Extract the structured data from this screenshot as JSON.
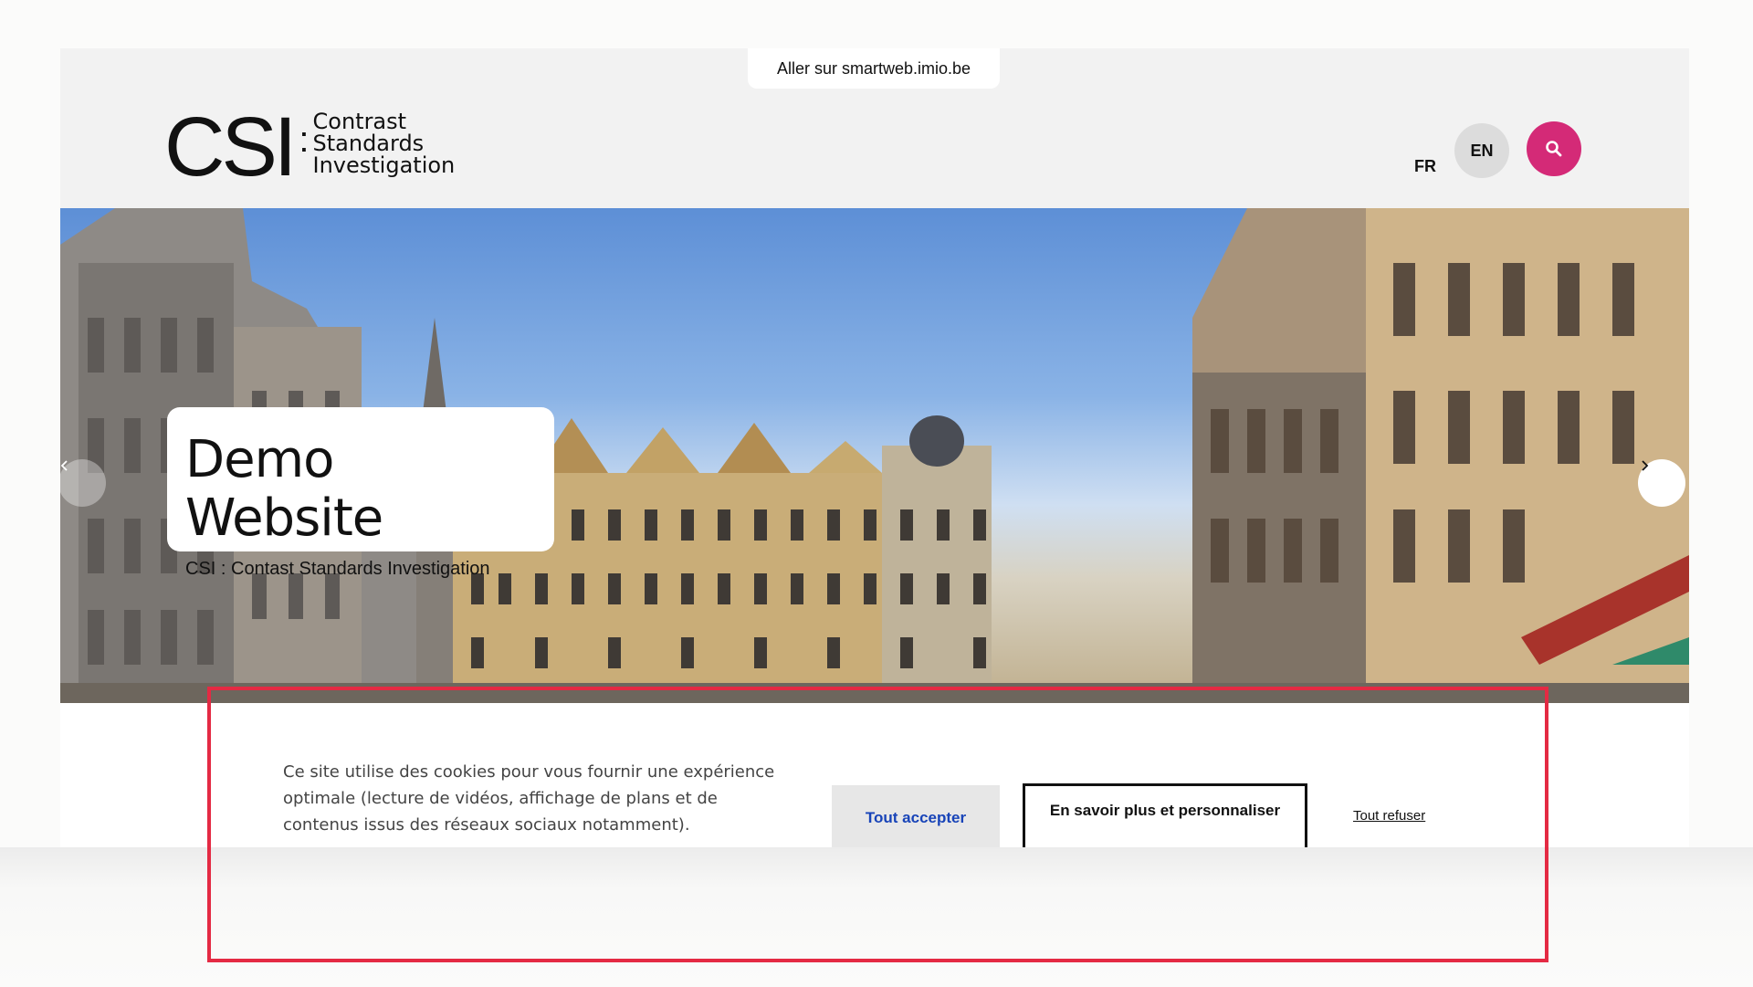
{
  "skip_link": "Aller sur smartweb.imio.be",
  "logo": {
    "mark": "CSI",
    "colon": ":",
    "lines": [
      "Contrast",
      "Standards",
      "Investigation"
    ]
  },
  "languages": {
    "fr": "FR",
    "en": "EN"
  },
  "icons": {
    "search": "search-icon",
    "prev": "chevron-left-icon",
    "next": "chevron-right-icon"
  },
  "hero": {
    "title": "Demo Website",
    "subtitle": "CSI : Contast Standards Investigation"
  },
  "cookie_banner": {
    "text": "Ce site utilise des cookies pour vous fournir une expérience optimale (lecture de vidéos, affichage de plans et de contenus issus des réseaux sociaux notamment).",
    "accept_label": "Tout accepter",
    "more_label": "En savoir plus et personnaliser",
    "refuse_label": "Tout refuser"
  },
  "colors": {
    "accent": "#d42a77",
    "accept_text": "#1844b8",
    "highlight": "#e42a43"
  }
}
